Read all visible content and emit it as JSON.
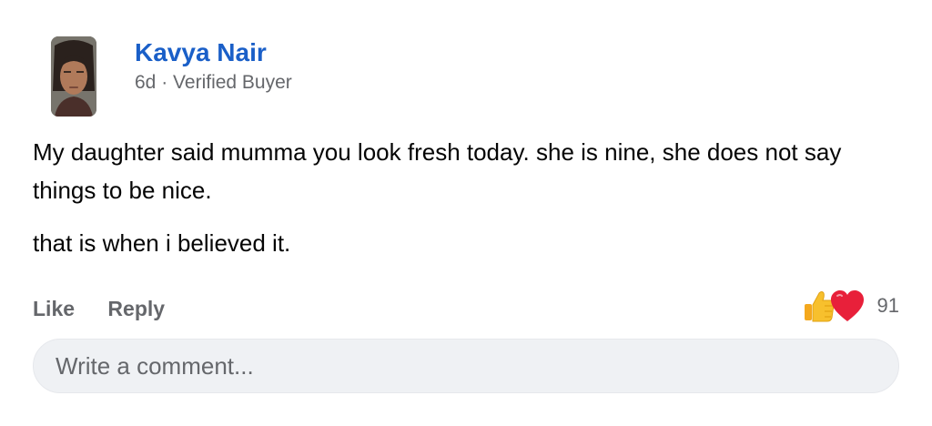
{
  "comment": {
    "author": "Kavya Nair",
    "age": "6d",
    "separator": "·",
    "badge": "Verified Buyer",
    "paragraphs": [
      "My daughter said mumma you look fresh today. she is nine, she does not say things to be nice.",
      "that is when i believed it."
    ]
  },
  "actions": {
    "like_label": "Like",
    "reply_label": "Reply"
  },
  "reactions": {
    "icons": [
      "thumbs-up-icon",
      "heart-icon"
    ],
    "count": "91"
  },
  "composer": {
    "placeholder": "Write a comment..."
  },
  "colors": {
    "author_link": "#1a5fc8",
    "secondary_text": "#65676b",
    "composer_bg": "#eff1f4",
    "heart": "#e8203a",
    "thumb": "#f7c02d"
  }
}
